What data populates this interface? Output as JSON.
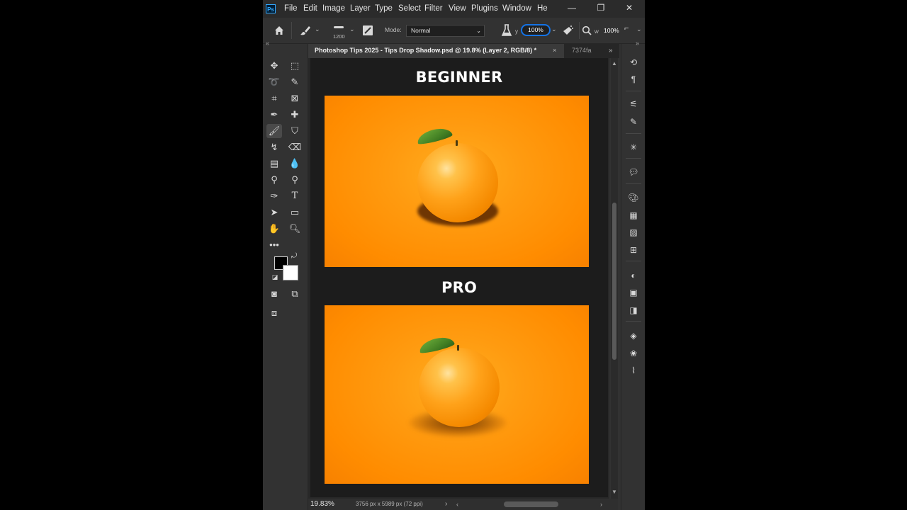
{
  "menubar": {
    "logo": "Ps",
    "items": [
      "File",
      "Edit",
      "Image",
      "Layer",
      "Type",
      "Select",
      "Filter",
      "View",
      "Plugins",
      "Window",
      "He"
    ],
    "window_controls": [
      "—",
      "❐",
      "✕"
    ]
  },
  "options": {
    "brush_size": "1200",
    "mode_label": "Mode:",
    "mode_value": "Normal",
    "opacity_value": "100%",
    "flow_value": "100%",
    "opacity_letter": "y",
    "flow_letter": "w"
  },
  "tabs": {
    "active": "Photoshop Tips 2025 - Tips Drop Shadow.psd @ 19.8% (Layer 2, RGB/8) *",
    "second": "7374fa",
    "close": "×",
    "more": "»"
  },
  "document": {
    "heading_top": "BEGINNER",
    "heading_bottom": "PRO"
  },
  "status": {
    "zoom": "19.83%",
    "dimensions": "3756 px x 5989 px (72 ppi)",
    "arrow": "›"
  },
  "toolbar": {
    "collapse": "«",
    "tools": [
      "move-tool",
      "marquee-tool",
      "lasso-tool",
      "quick-select-tool",
      "crop-tool",
      "frame-tool",
      "eyedropper-tool",
      "healing-tool",
      "brush-tool",
      "stamp-tool",
      "history-brush-tool",
      "eraser-tool",
      "gradient-tool",
      "blur-tool",
      "dodge-tool",
      "sponge-tool",
      "pen-tool",
      "type-tool",
      "path-select-tool",
      "rectangle-tool",
      "hand-tool",
      "zoom-tool",
      "more-tools"
    ],
    "colors": {
      "foreground": "#000000",
      "background": "#ffffff"
    }
  },
  "right_panel": {
    "collapse": "»",
    "icons": [
      "history-icon",
      "paragraph-icon",
      "adjust-icon",
      "brush-settings-icon",
      "magic-icon",
      "comment-icon",
      "palette-icon",
      "grid-icon",
      "gradient-icon",
      "pattern-icon",
      "adjustments-icon",
      "libraries-icon",
      "properties-icon",
      "layers-icon",
      "channels-icon",
      "paths-icon"
    ]
  },
  "colors": {
    "accent": "#1473e6",
    "app_bg": "#323232",
    "canvas_orange": "#ff9500"
  }
}
